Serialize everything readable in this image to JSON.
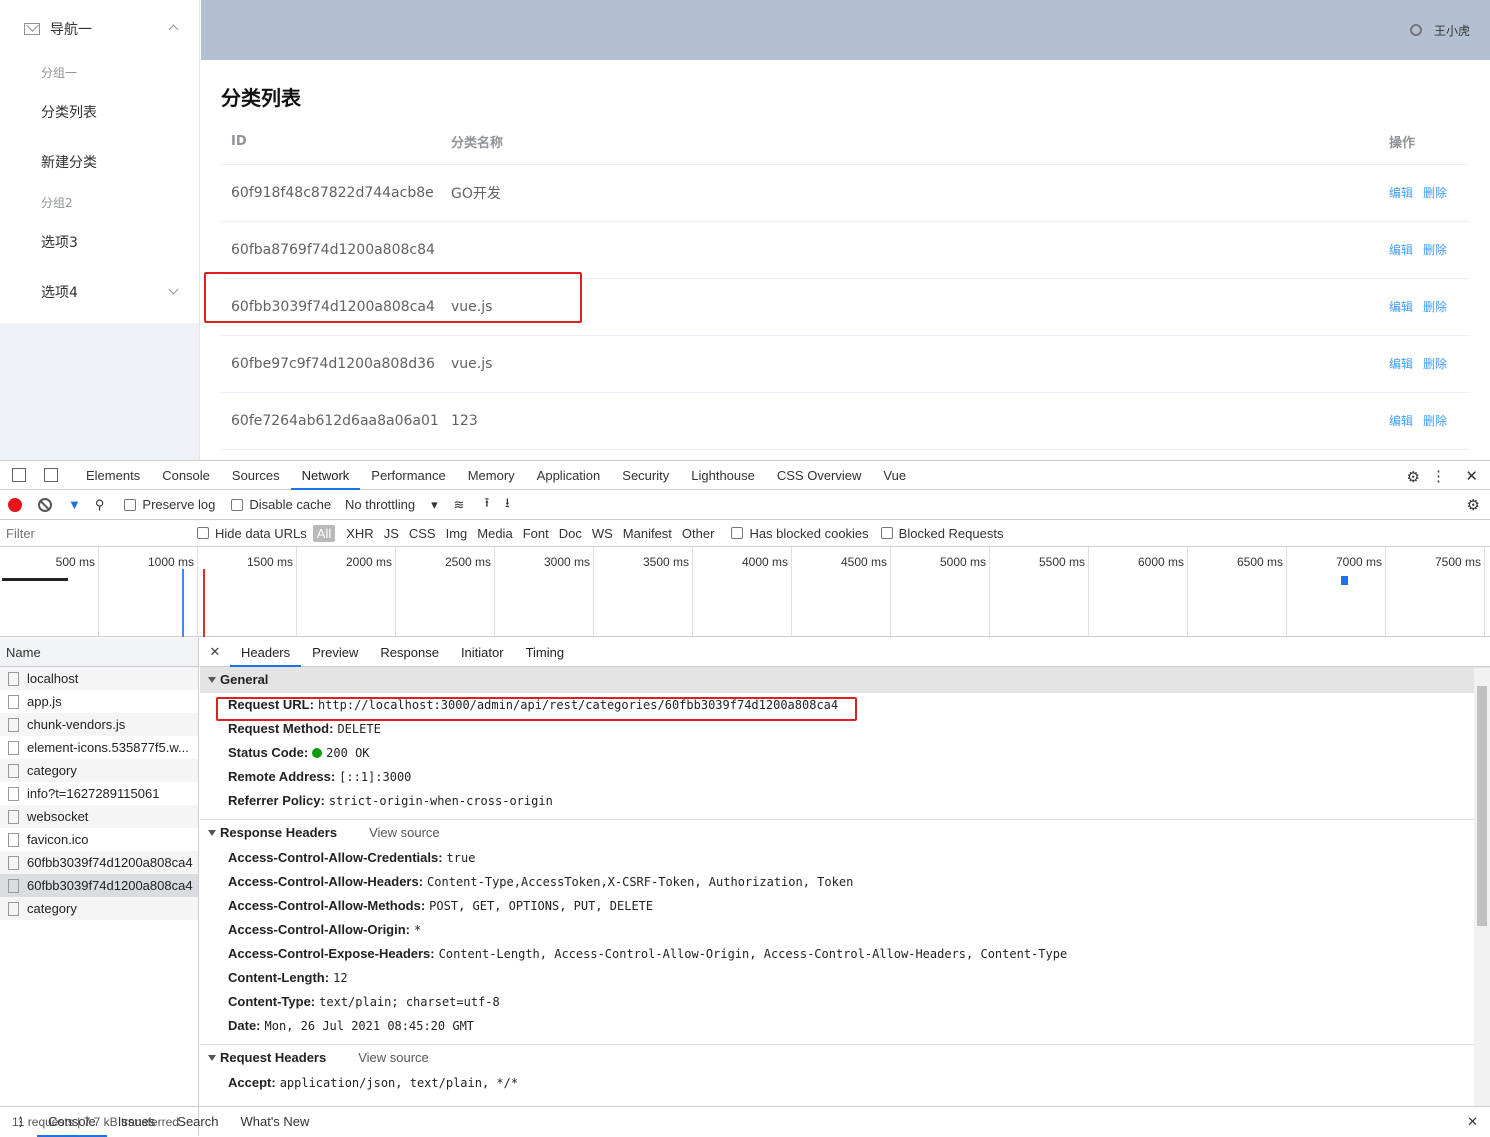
{
  "sidebar": {
    "nav_title": "导航一",
    "group1": "分组一",
    "item_category_list": "分类列表",
    "item_new_category": "新建分类",
    "group2": "分组2",
    "item_option3": "选项3",
    "item_option4": "选项4"
  },
  "header": {
    "user": "王小虎",
    "icon": "gear-icon"
  },
  "page": {
    "title": "分类列表",
    "columns": [
      "ID",
      "分类名称",
      "操作"
    ],
    "rows": [
      {
        "id": "60f918f48c87822d744acb8e",
        "name": "GO开发",
        "edit": "编辑",
        "del": "删除"
      },
      {
        "id": "60fba8769f74d1200a808c84",
        "name": "",
        "edit": "编辑",
        "del": "删除"
      },
      {
        "id": "60fbb3039f74d1200a808ca4",
        "name": "vue.js",
        "edit": "编辑",
        "del": "删除"
      },
      {
        "id": "60fbe97c9f74d1200a808d36",
        "name": "vue.js",
        "edit": "编辑",
        "del": "删除"
      },
      {
        "id": "60fe7264ab612d6aa8a06a01",
        "name": "123",
        "edit": "编辑",
        "del": "删除"
      }
    ]
  },
  "devtools": {
    "tabs": [
      "Elements",
      "Console",
      "Sources",
      "Network",
      "Performance",
      "Memory",
      "Application",
      "Security",
      "Lighthouse",
      "CSS Overview",
      "Vue"
    ],
    "active_tab": "Network",
    "toolbar": {
      "preserve_log": "Preserve log",
      "disable_cache": "Disable cache",
      "throttling": "No throttling"
    },
    "filter": {
      "placeholder": "Filter",
      "hide_data_urls": "Hide data URLs",
      "types": [
        "All",
        "XHR",
        "JS",
        "CSS",
        "Img",
        "Media",
        "Font",
        "Doc",
        "WS",
        "Manifest",
        "Other"
      ],
      "has_blocked": "Has blocked cookies",
      "blocked_requests": "Blocked Requests"
    },
    "timeline": [
      "500 ms",
      "1000 ms",
      "1500 ms",
      "2000 ms",
      "2500 ms",
      "3000 ms",
      "3500 ms",
      "4000 ms",
      "4500 ms",
      "5000 ms",
      "5500 ms",
      "6000 ms",
      "6500 ms",
      "7000 ms",
      "7500 ms"
    ],
    "name_header": "Name",
    "requests": [
      "localhost",
      "app.js",
      "chunk-vendors.js",
      "element-icons.535877f5.w...",
      "category",
      "info?t=1627289115061",
      "websocket",
      "favicon.ico",
      "60fbb3039f74d1200a808ca4",
      "60fbb3039f74d1200a808ca4",
      "category"
    ],
    "summary": "11 requests   |   7.7 kB transferred",
    "detail_tabs": [
      "Headers",
      "Preview",
      "Response",
      "Initiator",
      "Timing"
    ],
    "general": {
      "title": "General",
      "rows": [
        {
          "k": "Request URL:",
          "v": "http://localhost:3000/admin/api/rest/categories/60fbb3039f74d1200a808ca4"
        },
        {
          "k": "Request Method:",
          "v": "DELETE"
        },
        {
          "k": "Status Code:",
          "v": "200 OK"
        },
        {
          "k": "Remote Address:",
          "v": "[::1]:3000"
        },
        {
          "k": "Referrer Policy:",
          "v": "strict-origin-when-cross-origin"
        }
      ]
    },
    "response_headers": {
      "title": "Response Headers",
      "view_source": "View source",
      "rows": [
        {
          "k": "Access-Control-Allow-Credentials:",
          "v": "true"
        },
        {
          "k": "Access-Control-Allow-Headers:",
          "v": "Content-Type,AccessToken,X-CSRF-Token, Authorization, Token"
        },
        {
          "k": "Access-Control-Allow-Methods:",
          "v": "POST, GET, OPTIONS, PUT, DELETE"
        },
        {
          "k": "Access-Control-Allow-Origin:",
          "v": "*"
        },
        {
          "k": "Access-Control-Expose-Headers:",
          "v": "Content-Length, Access-Control-Allow-Origin, Access-Control-Allow-Headers, Content-Type"
        },
        {
          "k": "Content-Length:",
          "v": "12"
        },
        {
          "k": "Content-Type:",
          "v": "text/plain; charset=utf-8"
        },
        {
          "k": "Date:",
          "v": "Mon, 26 Jul 2021 08:45:20 GMT"
        }
      ]
    },
    "request_headers": {
      "title": "Request Headers",
      "view_source": "View source",
      "rows": [
        {
          "k": "Accept:",
          "v": "application/json, text/plain, */*"
        }
      ]
    },
    "drawer_tabs": [
      "Console",
      "Issues",
      "Search",
      "What's New"
    ]
  }
}
